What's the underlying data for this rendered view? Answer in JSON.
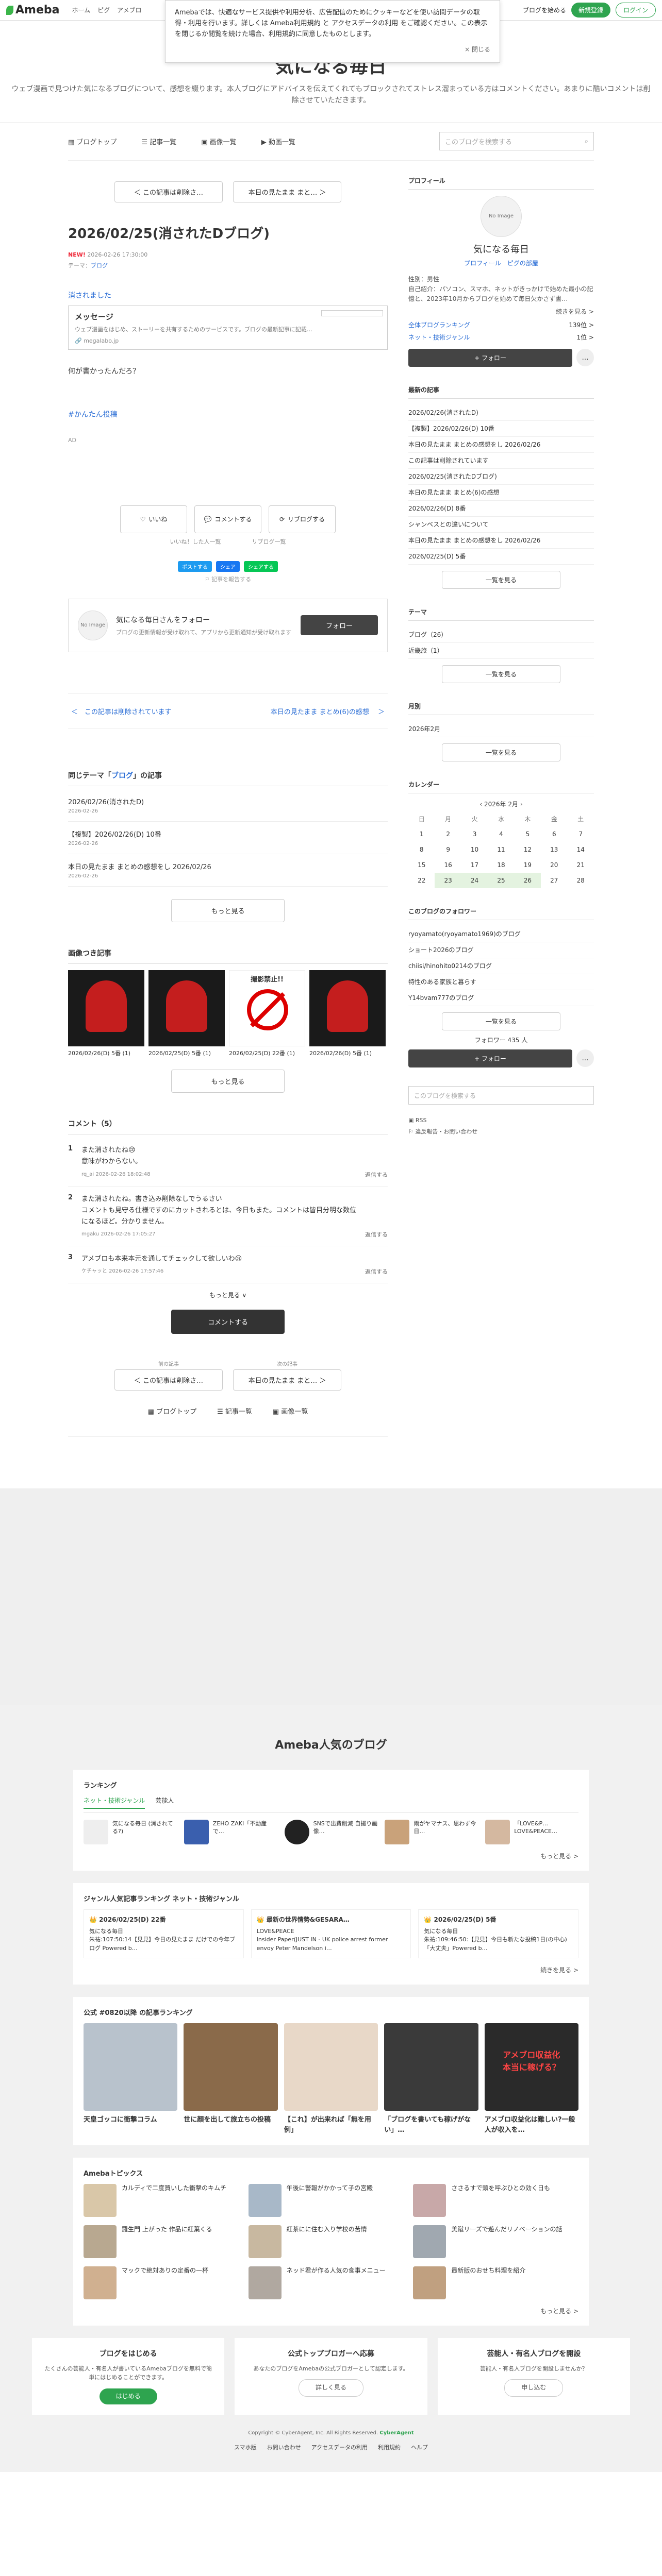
{
  "topbar": {
    "logo": "Ameba",
    "nav": [
      "ホーム",
      "ピグ",
      "アメブロ"
    ],
    "blog_start": "ブログを始める",
    "signup": "新規登録",
    "login": "ログイン"
  },
  "cookie": {
    "text": "Amebaでは、快適なサービス提供や利用分析、広告配信のためにクッキーなどを使い訪問データの取得・利用を行います。詳しくは Ameba利用規約 と アクセスデータの利用 をご確認ください。この表示を閉じるか閲覧を続けた場合、利用規約に同意したものとします。",
    "close": "× 閉じる"
  },
  "blog": {
    "title": "気になる毎日",
    "desc": "ウェブ漫画で見つけた気になるブログについて、感想を綴ります。本人ブログにアドバイスを伝えてくれてもブロックされてストレス溜まっている方はコメントください。あまりに酷いコメントは削除させていただきます。"
  },
  "subnav": {
    "items": [
      "ブログトップ",
      "記事一覧",
      "画像一覧",
      "動画一覧"
    ],
    "search_placeholder": "このブログを検索する"
  },
  "article": {
    "prev_top": "＜ この記事は削除さ…",
    "next_top": "本日の見たまま まと… ＞",
    "title": "2026/02/25(消されたDブログ)",
    "new_label": "NEW!",
    "date": "2026-02-26 17:30:00",
    "theme_label": "テーマ：",
    "theme": "ブログ",
    "deleted_link": "消されました",
    "card_title": "メッセージ",
    "card_desc": "ウェブ漫画をはじめ、ストーリーを共有するためのサービスです。ブログの最新記事に記載…",
    "card_url": "megalabo.jp",
    "body": "何が書かったんだろ？",
    "hashtag": "#かんたん投稿",
    "ad": "AD",
    "like": "いいね",
    "comment": "コメントする",
    "reblog": "リブログする",
    "like_list": "いいね！した人一覧",
    "reblog_list": "リブログ一覧",
    "share": [
      "ポストする",
      "シェア",
      "シェアする"
    ],
    "report": "記事を報告する",
    "follow_box_title": "気になる毎日さんをフォロー",
    "follow_box_sub": "ブログの更新情報が受け取れて、アプリから更新通知が受け取れます",
    "follow_btn": "フォロー",
    "pager_prev": "＜　この記事は削除されています",
    "pager_next": "本日の見たまま まとめ(6)の感想 　＞"
  },
  "same_theme": {
    "title_prefix": "同じテーマ「",
    "theme": "ブログ",
    "title_suffix": "」の記事",
    "items": [
      {
        "title": "2026/02/26(消されたD)",
        "date": "2026-02-26"
      },
      {
        "title": "【複製】2026/02/26(D) 10番",
        "date": "2026-02-26"
      },
      {
        "title": "本日の見たまま まとめの感想をし 2026/02/26",
        "date": "2026-02-26"
      }
    ],
    "more": "もっと見る"
  },
  "img_entries": {
    "title": "画像つき記事",
    "items": [
      {
        "cap": "2026/02/26(D) 5番\n(1)"
      },
      {
        "cap": "2026/02/25(D) 5番\n(1)"
      },
      {
        "cap": "2026/02/25(D) 22番\n(1)"
      },
      {
        "cap": "2026/02/26(D) 5番\n(1)"
      }
    ],
    "banned_text": "撮影禁止!!",
    "more": "もっと見る"
  },
  "comments": {
    "title": "コメント（5）",
    "items": [
      {
        "num": "1",
        "text": "また消されたね😢\n意味がわからない。",
        "meta": "rq_ai 2026-02-26 18:02:48",
        "reply": "返信する"
      },
      {
        "num": "2",
        "text": "また消されたね。書き込み削除なしでうるさい\nコメントも見守る仕様ですのにカットされるとは、今日もまた。コメントは皆目分明な数位になるほど。分かりません。",
        "meta": "mgaku 2026-02-26 17:05:27",
        "reply": "返信する"
      },
      {
        "num": "3",
        "text": "アメブロも本来本元を通してチェックして欲しいわ😢",
        "meta": "ケチャッと 2026-02-26 17:57:46",
        "reply": "返信する"
      }
    ],
    "more": "もっと見る ∨",
    "comment_btn": "コメントする"
  },
  "bottom": {
    "prev_label": "前の記事",
    "next_label": "次の記事",
    "prev": "＜ この記事は削除さ…",
    "next": "本日の見たまま まと… ＞",
    "nav": [
      "ブログトップ",
      "記事一覧",
      "画像一覧"
    ]
  },
  "sidebar": {
    "profile_title": "プロフィール",
    "no_image": "No Image",
    "name": "気になる毎日",
    "links": "プロフィール　ピグの部屋",
    "info": "性別：男性\n自己紹介：パソコン、スマホ、ネットがきっかけで始めた最小の記憶と、2023年10月からブログを始めて毎日欠かさず書…",
    "more": "続きを見る >",
    "rank1_label": "全体ブログランキング",
    "rank1_val": "139位 >",
    "rank2_label": "ネット・技術ジャンル",
    "rank2_val": "1位 >",
    "follow": "+ フォロー",
    "latest_title": "最新の記事",
    "latest": [
      "2026/02/26(消されたD)",
      "【複製】2026/02/26(D) 10番",
      "本日の見たまま まとめの感想をし 2026/02/26",
      "この記事は削除されています",
      "2026/02/25(消されたDブログ)",
      "本日の見たまま まとめ(6)の感想",
      "2026/02/26(D) 8番",
      "シャンベスとの違いについて",
      "本日の見たまま まとめの感想をし 2026/02/26",
      "2026/02/25(D) 5番"
    ],
    "list_more": "一覧を見る",
    "theme_title": "テーマ",
    "themes": [
      "ブログ（26）",
      "近畿旅（1）"
    ],
    "month_title": "月別",
    "months": [
      "2026年2月"
    ],
    "cal_title": "カレンダー",
    "cal_month": "2026年 2月",
    "dow": [
      "日",
      "月",
      "火",
      "水",
      "木",
      "金",
      "土"
    ],
    "cal_rows": [
      [
        "1",
        "2",
        "3",
        "4",
        "5",
        "6",
        "7"
      ],
      [
        "8",
        "9",
        "10",
        "11",
        "12",
        "13",
        "14"
      ],
      [
        "15",
        "16",
        "17",
        "18",
        "19",
        "20",
        "21"
      ],
      [
        "22",
        "23",
        "24",
        "25",
        "26",
        "27",
        "28"
      ]
    ],
    "followers_title": "このブログのフォロワー",
    "followers": [
      "ryoyamato(ryoyamato1969)のブログ",
      "ショート2026のブログ",
      "chiisi/hinohito0214のブログ",
      "特性のある家族と暮らす",
      "Y14bvam777のブログ"
    ],
    "follower_count": "フォロワー 435 人",
    "search_placeholder": "このブログを検索する",
    "report_links": [
      "RSS",
      "違反報告・お問い合わせ"
    ]
  },
  "footer": {
    "pop_title": "Ameba人気のブログ",
    "ranking_title": "ランキング",
    "ranking_tabs": [
      "ネット・技術ジャンル",
      "芸能人"
    ],
    "ranking_items": [
      "気になる毎日 (消されてる?)",
      "ZEHO ZAKI「不動産で…",
      "SNSで出費削減 自撮り画像…",
      "雨がヤマナス、思わず今日…",
      "「LOVE&P… LOVE&PEACE…"
    ],
    "more": "もっと見る >",
    "genre_title": "ジャンル人気記事ランキング ネット・技術ジャンル",
    "genre_cards": [
      {
        "h": "👑 2026/02/25(D) 22番",
        "t": "気になる毎日\n朱祐:107:50:14【見見】今日の見たまま だけでの今年ブログ Powered b…"
      },
      {
        "h": "👑 最新の世界情勢&GESARA…",
        "t": "LOVE&PEACE\nInsider Paper(JUST IN - UK police arrest former envoy Peter Mandelson i…"
      },
      {
        "h": "👑 2026/02/25(D) 5番",
        "t": "気になる毎日\n朱祐:109:46:50:【見見】今日も新たな投稿1日(の中心)「大丈夫」Powered b…"
      }
    ],
    "genre_more": "続きを見る >",
    "official_title": "公式 #0820以降 の記事ランキング",
    "official_cards": [
      {
        "t": "天皇ゴッコに衝撃コラム"
      },
      {
        "t": "世に顔を出して旅立ちの投稿"
      },
      {
        "t": "【これ】が出来れば「無を用例」"
      },
      {
        "t": "「ブログを書いても稼げがない」…"
      },
      {
        "t": "アメブロ収益化は難しい?一般人が収入を…"
      }
    ],
    "official_banner": "アメブロ収益化\n本当に稼げる？",
    "topics_title": "Amebaトピックス",
    "topics": [
      "カルディで二度買いした衝撃のキムチ",
      "午後に警報がかかって子の宮殿",
      "ささるすで頭を呼ぶひとの効く日も",
      "羅生門 上がった 作品に紅葉くる",
      "紅茶にに住む入り学校の苦情",
      "美蹴リーズで遊んだリノベーションの話",
      "マックで絶対ありの定番の一杯",
      "ネッド君が作る人気の食事メニュー",
      "最新版のおせち料理を紹介"
    ],
    "promo": [
      {
        "h": "ブログをはじめる",
        "t": "たくさんの芸能人・有名人が書いているAmebaブログを無料で簡単にはじめることができます。",
        "b": "はじめる",
        "sub": "公式トップブロガーへ応募"
      },
      {
        "h": "公式トップブロガーへ応募",
        "t": "あなたのブログをAmebaの公式ブロガーとして認定します。",
        "b": "詳しく見る",
        "sub": ""
      },
      {
        "h": "芸能人・有名人ブログを開設",
        "t": "芸能人・有名人ブログを開設しませんか？",
        "b": "申し込む",
        "sub": ""
      }
    ],
    "copyright": "Copyright © CyberAgent, Inc. All Rights Reserved.",
    "brand": "CyberAgent",
    "links": [
      "スマホ版",
      "お問い合わせ",
      "アクセスデータの利用",
      "利用規約",
      "ヘルプ"
    ]
  }
}
